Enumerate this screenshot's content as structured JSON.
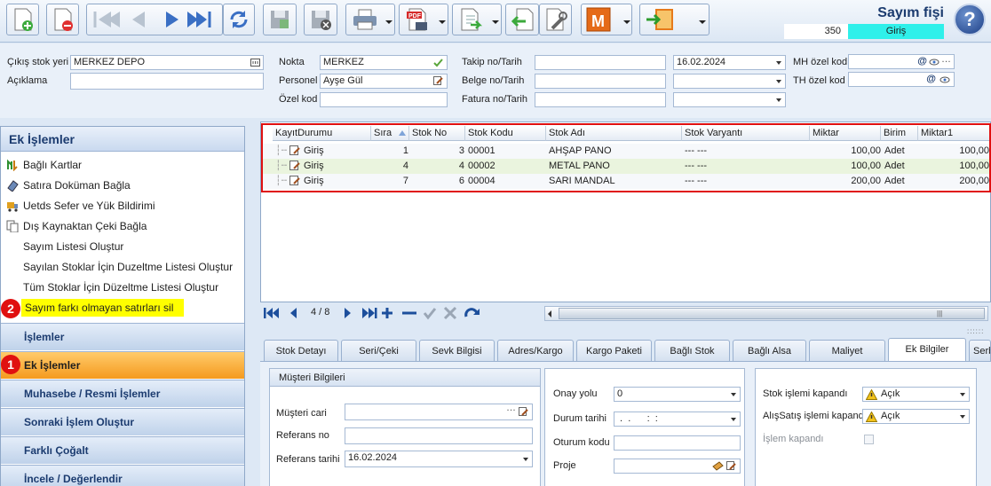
{
  "header": {
    "title": "Sayım fişi",
    "doc_no": "350",
    "doc_type": "Giriş",
    "help": "?"
  },
  "form": {
    "cikis_stok_yeri": {
      "label": "Çıkış stok yeri",
      "value": "MERKEZ DEPO"
    },
    "aciklama": {
      "label": "Açıklama",
      "value": ""
    },
    "nokta": {
      "label": "Nokta",
      "value": "MERKEZ"
    },
    "personel": {
      "label": "Personel",
      "value": "Ayşe Gül"
    },
    "ozel_kod": {
      "label": "Özel kod",
      "value": ""
    },
    "takip": {
      "label": "Takip no/Tarih",
      "value": "",
      "date": "16.02.2024"
    },
    "belge": {
      "label": "Belge no/Tarih",
      "value": ""
    },
    "fatura": {
      "label": "Fatura no/Tarih",
      "value": ""
    },
    "mh_ozel_kod": {
      "label": "MH özel kod",
      "value": ""
    },
    "th_ozel_kod": {
      "label": "TH özel kod",
      "value": ""
    }
  },
  "ek_panel": {
    "title": "Ek İşlemler",
    "items": [
      {
        "label": "Bağlı Kartlar",
        "icon": "linked-cards-icon"
      },
      {
        "label": "Satıra Doküman Bağla",
        "icon": "attach-document-icon"
      },
      {
        "label": "Uetds Sefer ve Yük Bildirimi",
        "icon": "truck-icon"
      },
      {
        "label": "Dış Kaynaktan Çeki Bağla",
        "icon": "copy-icon"
      },
      {
        "label": "Sayım Listesi Oluştur",
        "icon": ""
      },
      {
        "label": "Sayılan Stoklar İçin Duzeltme Listesi Oluştur",
        "icon": ""
      },
      {
        "label": "Tüm Stoklar İçin Düzeltme Listesi Oluştur",
        "icon": ""
      },
      {
        "label": "Sayım farkı olmayan satırları sil",
        "icon": ""
      }
    ],
    "nav": [
      "İşlemler",
      "Ek İşlemler",
      "Muhasebe / Resmi İşlemler",
      "Sonraki İşlem Oluştur",
      "Farklı Çoğalt",
      "İncele / Değerlendir"
    ],
    "badges": [
      "1",
      "2"
    ]
  },
  "grid": {
    "columns": [
      "KayıtDurumu",
      "Sıra",
      "Stok No",
      "Stok Kodu",
      "Stok Adı",
      "Stok Varyantı",
      "Miktar",
      "Birim",
      "Miktar1"
    ],
    "rows": [
      {
        "durum": "Giriş",
        "sira": "1",
        "stok_no": "3",
        "stok_kodu": "00001",
        "stok_adi": "AHŞAP PANO",
        "varyant": "--- ---",
        "miktar": "100,00",
        "birim": "Adet",
        "miktar1": "100,00"
      },
      {
        "durum": "Giriş",
        "sira": "4",
        "stok_no": "4",
        "stok_kodu": "00002",
        "stok_adi": "METAL PANO",
        "varyant": "--- ---",
        "miktar": "100,00",
        "birim": "Adet",
        "miktar1": "100,00"
      },
      {
        "durum": "Giriş",
        "sira": "7",
        "stok_no": "6",
        "stok_kodu": "00004",
        "stok_adi": "SARI MANDAL",
        "varyant": "--- ---",
        "miktar": "200,00",
        "birim": "Adet",
        "miktar1": "200,00"
      }
    ]
  },
  "pager": {
    "position": "4 / 8"
  },
  "tabs": [
    "Stok Detayı",
    "Seri/Çeki",
    "Sevk Bilgisi",
    "Adres/Kargo",
    "Kargo Paketi",
    "Bağlı Stok",
    "Bağlı Alsa",
    "Maliyet",
    "Ek Bilgiler",
    "Serb"
  ],
  "active_tab": "Ek Bilgiler",
  "musteri": {
    "group_title": "Müşteri Bilgileri",
    "musteri_cari": {
      "label": "Müşteri cari",
      "value": ""
    },
    "referans_no": {
      "label": "Referans no",
      "value": ""
    },
    "referans_tarihi": {
      "label": "Referans tarihi",
      "value": "16.02.2024"
    }
  },
  "onay": {
    "onay_yolu": {
      "label": "Onay yolu",
      "value": "0"
    },
    "durum_tarihi": {
      "label": "Durum tarihi",
      "value": " .  .      :  :"
    },
    "oturum_kodu": {
      "label": "Oturum kodu",
      "value": ""
    },
    "proje": {
      "label": "Proje",
      "value": ""
    }
  },
  "kapanis": {
    "stok": {
      "label": "Stok işlemi kapandı",
      "value": "Açık"
    },
    "alissatis": {
      "label": "AlışSatış işlemi kapandı",
      "value": "Açık"
    },
    "islem": {
      "label": "İşlem kapandı"
    }
  },
  "colors": {
    "accent": "#1b3b6f",
    "highlight": "#ffff00",
    "active_nav": "#f59a1e",
    "doc_type_bg": "#2ff0ea",
    "badge": "#e01010"
  }
}
